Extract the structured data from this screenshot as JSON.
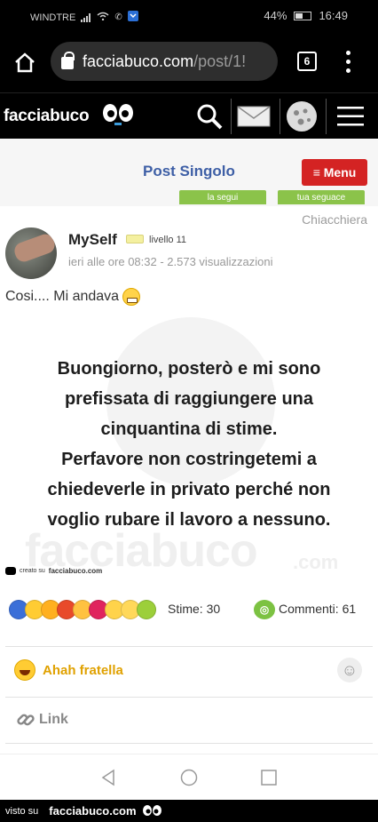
{
  "status_bar": {
    "carrier": "WINDTRE",
    "battery": "44%",
    "time": "16:49"
  },
  "browser": {
    "url_domain": "facciabuco.com",
    "url_path": "/post/1!",
    "tab_count": "6"
  },
  "site": {
    "logo": "facciabuco"
  },
  "post_header": {
    "title": "Post Singolo",
    "menu_label": "≡ Menu",
    "follow_tab": "la segui",
    "follower_tab": "tua seguace"
  },
  "post": {
    "category": "Chiacchiera",
    "username": "MySelf",
    "level": "livello 11",
    "meta": "ieri alle ore 08:32 - 2.573 visualizzazioni",
    "text": "Cosi.... Mi andava",
    "image_text": "Buongiorno, posterò e mi sono\nprefissata di raggiungere una\ncinquantina di stime.\nPerfavore non costringetemi a\nchiedeverle in privato perché non\nvoglio rubare il lavoro a nessuno.",
    "watermark": "facciabuco",
    "watermark_com": ".com",
    "created_prefix": "creato su",
    "created_site": "facciabuco.com"
  },
  "stats": {
    "stime": "Stime: 30",
    "comments": "Commenti: 61"
  },
  "actions": {
    "reaction_label": "Ahah fratella",
    "link_label": "Link"
  },
  "footer": {
    "prefix": "visto su",
    "brand": "facciabuco.com"
  },
  "colors": {
    "brand_blue": "#3e5fa6",
    "menu_red": "#d42323",
    "tab_green": "#8bc34a",
    "reaction_gold": "#e0a100"
  }
}
